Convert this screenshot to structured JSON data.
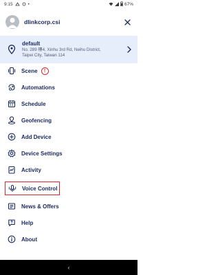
{
  "status_bar": {
    "time": "9:15",
    "battery": "67%"
  },
  "header": {
    "username": "dlinkcorp.csi"
  },
  "location": {
    "name": "default",
    "address_line1": "No. 289 樓4, Xinhu 3rd Rd, Neihu District,",
    "address_line2": "Taipei City, Taiwan 114"
  },
  "menu": {
    "scene": "Scene",
    "scene_alert": "!",
    "automations": "Automations",
    "schedule": "Schedule",
    "geofencing": "Geofencing",
    "add_device": "Add Device",
    "device_settings": "Device Settings",
    "activity": "Activity",
    "voice_control": "Voice Control",
    "news": "News & Offers",
    "help": "Help",
    "about": "About"
  },
  "nav": {
    "back_glyph": "‹"
  },
  "colors": {
    "text": "#1a2a5c",
    "location_bg": "#e6eefb",
    "highlight": "#d9262e",
    "alert": "#d62929"
  }
}
